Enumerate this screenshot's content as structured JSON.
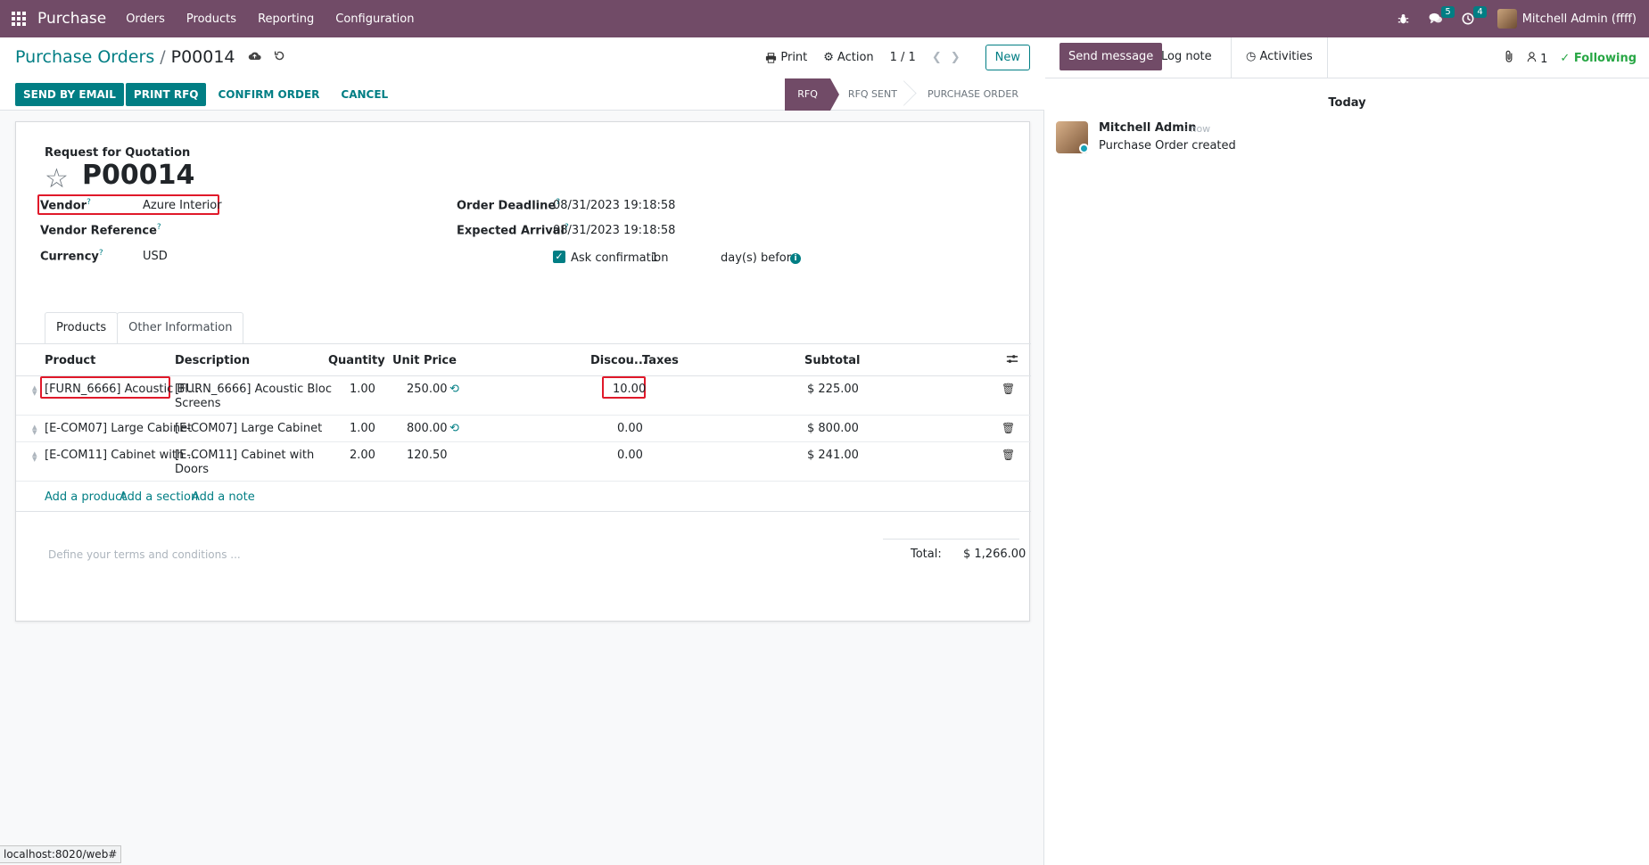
{
  "topbar": {
    "brand": "Purchase",
    "menu": [
      "Orders",
      "Products",
      "Reporting",
      "Configuration"
    ],
    "messages_badge": "5",
    "activities_badge": "4",
    "user": "Mitchell Admin (ffff)"
  },
  "control": {
    "breadcrumb_parent": "Purchase Orders",
    "breadcrumb_current": "P00014",
    "print": "Print",
    "action": "Action",
    "pager": "1 / 1",
    "new": "New"
  },
  "actions": {
    "send_email": "SEND BY EMAIL",
    "print_rfq": "PRINT RFQ",
    "confirm": "CONFIRM ORDER",
    "cancel": "CANCEL"
  },
  "stages": [
    "RFQ",
    "RFQ SENT",
    "PURCHASE ORDER"
  ],
  "form": {
    "doc_type": "Request for Quotation",
    "name": "P00014",
    "vendor_label": "Vendor",
    "vendor": "Azure Interior",
    "vendor_ref_label": "Vendor Reference",
    "currency_label": "Currency",
    "currency": "USD",
    "deadline_label": "Order Deadline",
    "deadline": "08/31/2023 19:18:58",
    "arrival_label": "Expected Arrival",
    "arrival": "08/31/2023 19:18:58",
    "ask_confirmation_label": "Ask confirmation",
    "ask_confirmation_days": "1",
    "days_before": "day(s) before"
  },
  "tabs": [
    "Products",
    "Other Information"
  ],
  "table": {
    "headers": {
      "product": "Product",
      "description": "Description",
      "quantity": "Quantity",
      "unit_price": "Unit Price",
      "discount": "Discou...",
      "taxes": "Taxes",
      "subtotal": "Subtotal"
    },
    "rows": [
      {
        "product": "[FURN_6666] Acoustic Bl...",
        "desc1": "[FURN_6666] Acoustic Bloc",
        "desc2": "Screens",
        "qty": "1.00",
        "price": "250.00",
        "discount": "10.00",
        "subtotal": "$ 225.00"
      },
      {
        "product": "[E-COM07] Large Cabinet",
        "desc1": "[E-COM07] Large Cabinet",
        "desc2": "",
        "qty": "1.00",
        "price": "800.00",
        "discount": "0.00",
        "subtotal": "$ 800.00"
      },
      {
        "product": "[E-COM11] Cabinet with ...",
        "desc1": "[E-COM11] Cabinet with",
        "desc2": "Doors",
        "qty": "2.00",
        "price": "120.50",
        "discount": "0.00",
        "subtotal": "$ 241.00"
      }
    ],
    "add_product": "Add a product",
    "add_section": "Add a section",
    "add_note": "Add a note"
  },
  "footer": {
    "terms_placeholder": "Define your terms and conditions ...",
    "total_label": "Total:",
    "total_value": "$ 1,266.00"
  },
  "status_url": "localhost:8020/web#",
  "chatter": {
    "send_message": "Send message",
    "log_note": "Log note",
    "activities": "Activities",
    "followers_count": "1",
    "following": "Following",
    "today": "Today",
    "author": "Mitchell Admin",
    "time": "- now",
    "body": "Purchase Order created"
  },
  "colors": {
    "brand": "#714B67",
    "accent": "#017E84",
    "highlight": "#e0192a"
  }
}
